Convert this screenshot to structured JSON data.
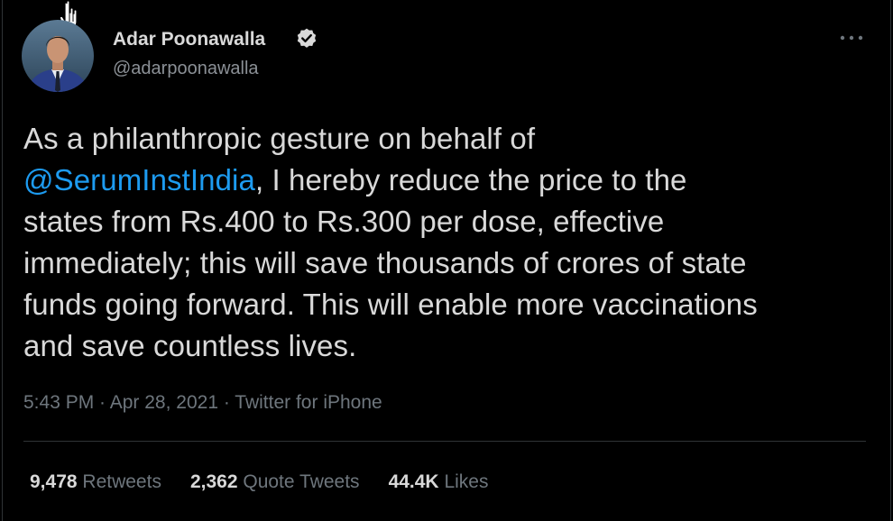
{
  "author": {
    "name": "Adar Poonawalla",
    "handle": "@adarpoonawalla",
    "verified": true
  },
  "tweet": {
    "line1": "As a philanthropic gesture on behalf of",
    "mention": "@SerumInstIndia",
    "line2_rest": ", I hereby reduce the price to the",
    "line3": "states from Rs.400 to Rs.300 per dose, effective",
    "line4": "immediately; this will save thousands of crores of state",
    "line5": "funds going forward. This will enable more vaccinations",
    "line6": "and save countless lives."
  },
  "meta": {
    "time": "5:43 PM",
    "sep1": " · ",
    "date": "Apr 28, 2021",
    "sep2": " · ",
    "source": "Twitter for iPhone"
  },
  "stats": {
    "retweets_count": "9,478",
    "retweets_label": "Retweets",
    "quotes_count": "2,362",
    "quotes_label": "Quote Tweets",
    "likes_count": "44.4K",
    "likes_label": "Likes"
  },
  "icons": {
    "more": "more-dots-icon",
    "verified": "verified-badge-icon",
    "cursor": "hand-cursor-icon"
  },
  "colors": {
    "background": "#000000",
    "text": "#d9d9d9",
    "secondary": "#6e767d",
    "link": "#1d9bf0",
    "divider": "#2f3336"
  }
}
